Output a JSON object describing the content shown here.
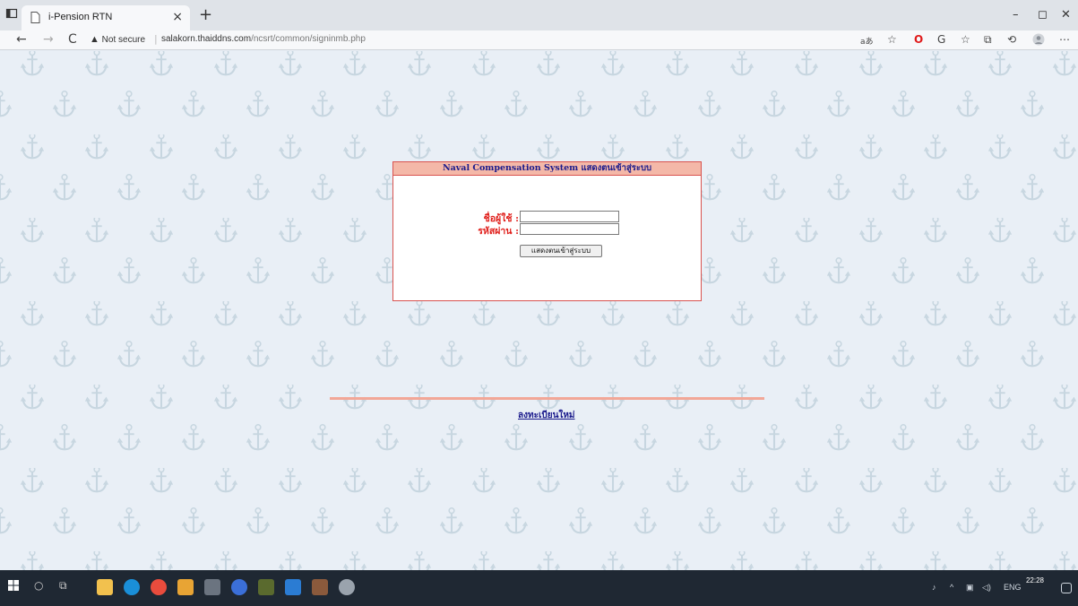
{
  "browser": {
    "tab_title": "i-Pension RTN",
    "tab_close": "×",
    "new_tab": "+",
    "back": "←",
    "forward": "→",
    "refresh": "C",
    "security_label": "Not secure",
    "url_host": "salakorn.thaiddns.com",
    "url_path": "/ncsrt/common/signinmb.php",
    "minimize": "–",
    "restore": "◻",
    "close": "✕"
  },
  "login": {
    "header": "Naval Compensation System แสดงตนเข้าสู่ระบบ",
    "username_label": "ชื่อผู้ใช้ :",
    "username_value": "",
    "password_label": "รหัสผ่าน :",
    "password_value": "",
    "submit_label": "แสดงตนเข้าสู่ระบบ"
  },
  "register_link": "ลงทะเบียนใหม่",
  "taskbar": {
    "time": "22:28",
    "lang": "ENG"
  },
  "colors": {
    "box_border": "#d9534f",
    "header_bg": "#f4b8a8",
    "label_red": "#e0201c",
    "header_text": "#1a1a8c",
    "page_bg": "#e9eff6"
  }
}
